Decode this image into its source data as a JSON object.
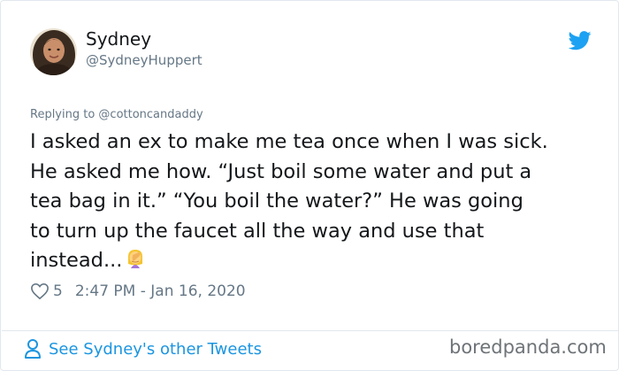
{
  "tweet": {
    "author_name": "Sydney",
    "author_handle": "@SydneyHuppert",
    "replying_to": "Replying to @cottoncandaddy",
    "lines": [
      "I asked an ex to make me tea once when I was sick.",
      "He asked me how.  “Just boil some water and put a",
      "tea bag in it.”  “You boil the water?”  He was going",
      "to turn up the faucet all the way and use that",
      "instead..."
    ],
    "emoji": "woman-facepalming-emoji",
    "like_count": "5",
    "timestamp": "2:47 PM - Jan 16, 2020",
    "see_more_label": "See Sydney's other Tweets"
  },
  "watermark": "boredpanda.com",
  "icons": {
    "platform_logo": "twitter-bird-icon",
    "like": "heart-icon",
    "profile": "person-icon"
  },
  "colors": {
    "twitter_blue": "#1da1f2",
    "link_blue": "#1b95e0",
    "secondary_text": "#657786",
    "primary_text": "#14171a",
    "border": "#e1e8ed"
  }
}
